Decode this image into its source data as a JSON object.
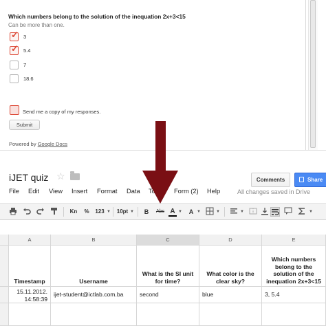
{
  "form": {
    "question_title": "Which numbers belong to the solution of the inequation 2x+3<15",
    "help_text": "Can be more than one.",
    "options": [
      {
        "label": "3",
        "checked": true
      },
      {
        "label": "5.4",
        "checked": true
      },
      {
        "label": "7",
        "checked": false
      },
      {
        "label": "18.6",
        "checked": false
      }
    ],
    "copy_label": "Send me a copy of my responses.",
    "submit_label": "Submit",
    "powered_prefix": "Powered by ",
    "powered_link": "Google Docs"
  },
  "sheet": {
    "title": "iJET quiz",
    "comments_label": "Comments",
    "share_label": "Share",
    "menu": [
      "File",
      "Edit",
      "View",
      "Insert",
      "Format",
      "Data",
      "Tools",
      "Form (2)",
      "Help"
    ],
    "save_status": "All changes saved in Drive",
    "toolbar": {
      "currency_label": "Kn",
      "percent_label": "%",
      "number_format_label": "123",
      "font_size_label": "10pt",
      "bold_label": "B",
      "strikethrough_label": "Abc",
      "text_color_label": "A",
      "fill_color_label": "A"
    },
    "columns": [
      "A",
      "B",
      "C",
      "D",
      "E"
    ],
    "header_row": {
      "A": "Timestamp",
      "B": "Username",
      "C": "What is the SI unit for time?",
      "D": "What color is the clear sky?",
      "E": "Which numbers belong to the solution of the inequation 2x+3<15"
    },
    "data_row": {
      "timestamp_date": "15.11.2012.",
      "timestamp_time": "14:58:39",
      "username": "ijet-student@ictlab.com.ba",
      "si_unit": "second",
      "sky_color": "blue",
      "numbers": "3, 5.4"
    }
  },
  "colors": {
    "checkbox_accent": "#dd4b39",
    "share_button": "#4a8af4",
    "arrow": "#7a0f14"
  }
}
